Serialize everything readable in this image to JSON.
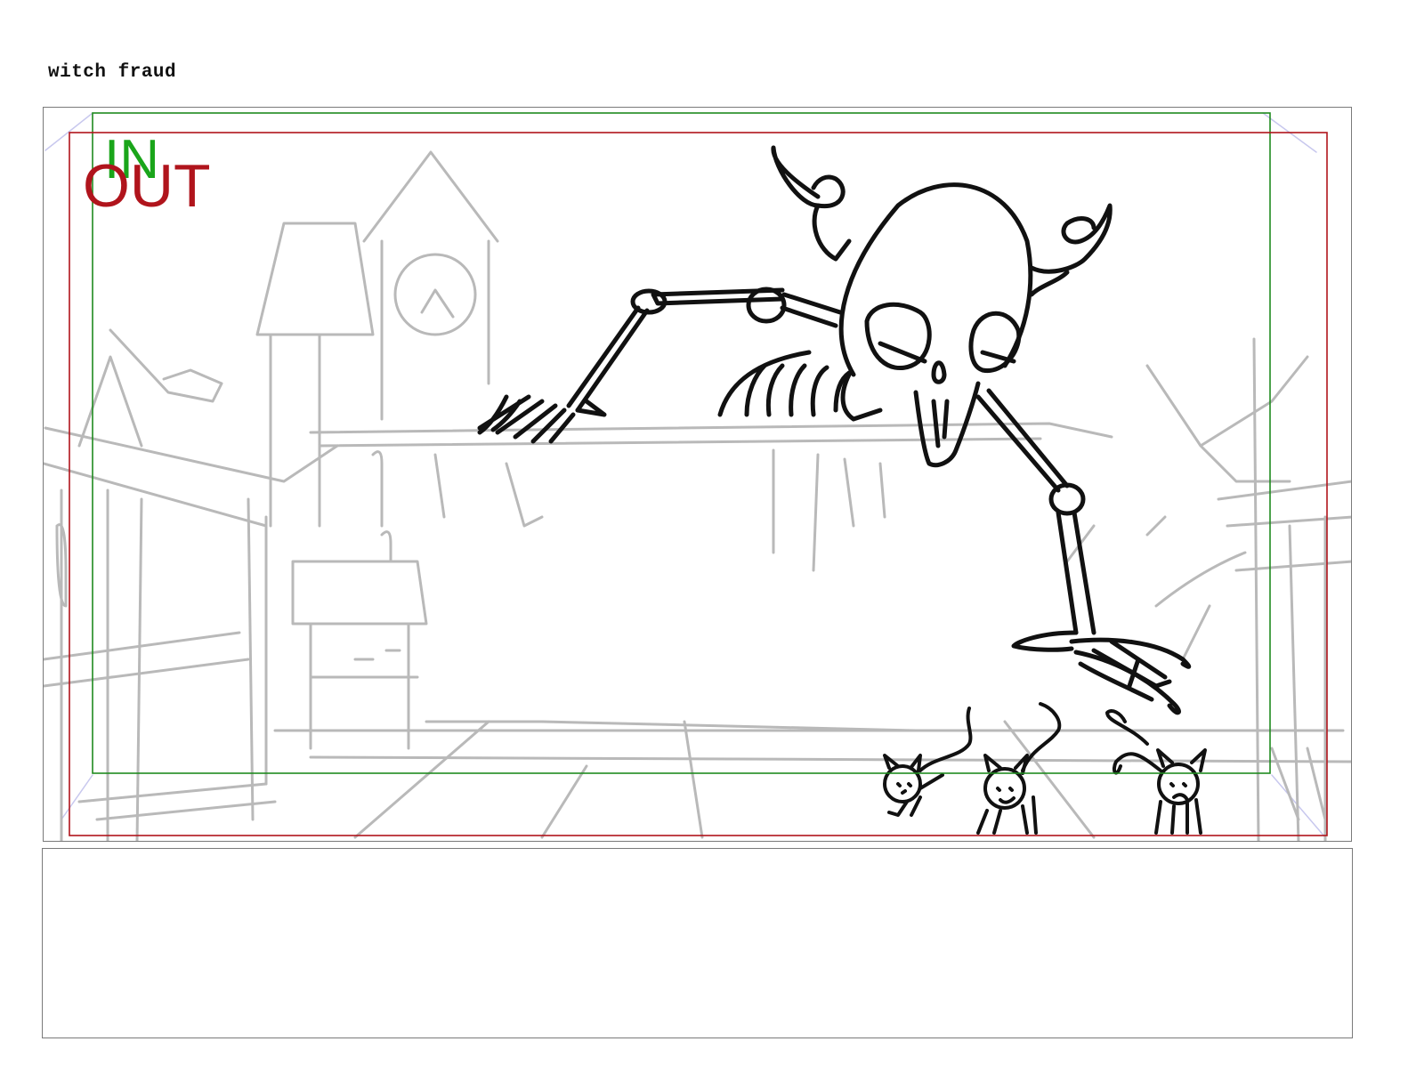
{
  "scene": {
    "title": "witch fraud"
  },
  "panel": {
    "frame_in_label": "IN",
    "frame_out_label": "OUT",
    "frame_in_color": "#1f8a1f",
    "frame_out_color": "#b0141c",
    "sketch_color": "#b9b9b9",
    "ink_color": "#111111"
  },
  "notes": {
    "text": ""
  }
}
